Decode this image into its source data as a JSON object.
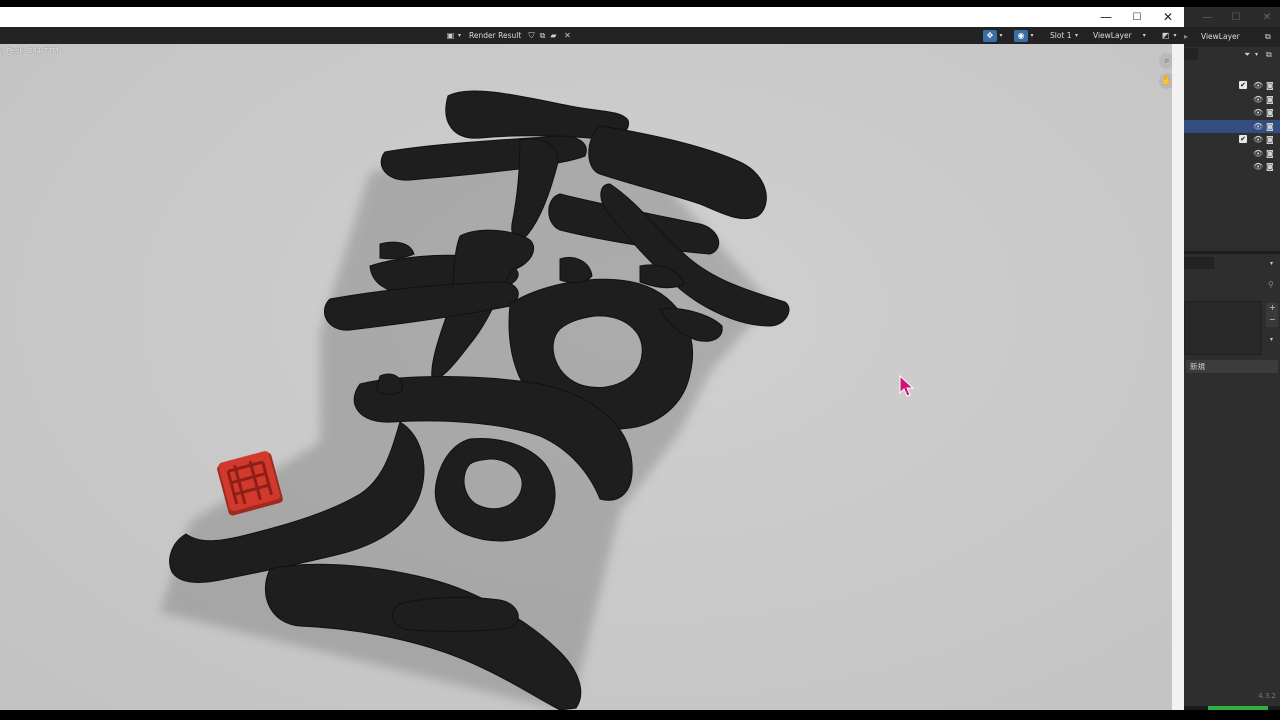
{
  "window": {
    "controls": [
      "—",
      "☐",
      "✕"
    ],
    "secondary_controls": [
      "—",
      "☐",
      "✕"
    ]
  },
  "image_editor": {
    "image_name": "Render Result",
    "slot": "Slot 1",
    "view_layer": "ViewLayer",
    "stats_text": "/, Peak: 284.77M"
  },
  "outliner": {
    "view_layer": "ViewLayer",
    "rows": [
      {
        "checked": true,
        "selected": false
      },
      {
        "checked": false,
        "selected": false
      },
      {
        "checked": false,
        "selected": false
      },
      {
        "checked": false,
        "selected": true
      },
      {
        "checked": true,
        "selected": false
      },
      {
        "checked": false,
        "selected": false
      },
      {
        "checked": false,
        "selected": false
      }
    ]
  },
  "properties": {
    "new_button": "新規",
    "version": "4.3.2"
  },
  "colors": {
    "text_color": "#1e1e1e",
    "seal_color": "#d0392b",
    "selection": "#334d80",
    "cursor": "#d1147a"
  }
}
